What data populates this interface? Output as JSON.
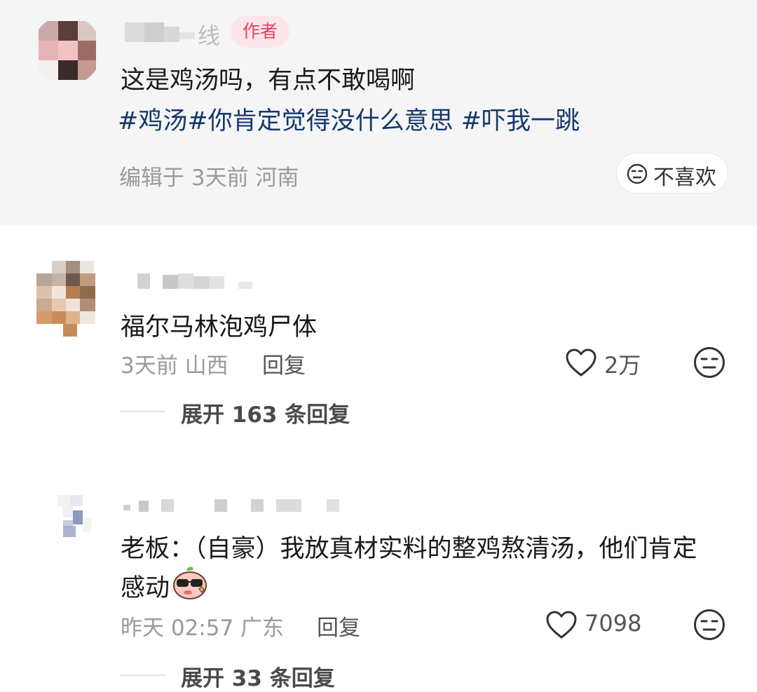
{
  "author_comment": {
    "username_visible_suffix": "线",
    "author_badge": "作者",
    "text": "这是鸡汤吗，有点不敢喝啊",
    "hashtags": "#鸡汤#你肯定觉得没什么意思 #吓我一跳",
    "meta": "编辑于  3天前  河南",
    "dislike_label": "不喜欢",
    "dislike_icon": "neutral-face-icon"
  },
  "comments": [
    {
      "text": "福尔马林泡鸡尸体",
      "meta": "3天前  山西",
      "reply_label": "回复",
      "likes": "2万",
      "like_icon": "heart-outline-icon",
      "dislike_icon": "neutral-face-icon",
      "expand": "展开 163 条回复"
    },
    {
      "text_line1": "老板：（自豪）我放真材实料的整鸡熬清汤，他们肯定",
      "text_line2": "感动",
      "emoji": "cool-sunglasses-sticker",
      "meta": "昨天 02:57  广东",
      "reply_label": "回复",
      "likes": "7098",
      "like_icon": "heart-outline-icon",
      "dislike_icon": "neutral-face-icon",
      "expand": "展开 33 条回复"
    }
  ],
  "colors": {
    "author_bg": "#f5f5f5",
    "badge_bg": "#fde6ea",
    "badge_text": "#ee3d5c",
    "hashtag": "#13386c",
    "meta": "#9a9a9a"
  }
}
